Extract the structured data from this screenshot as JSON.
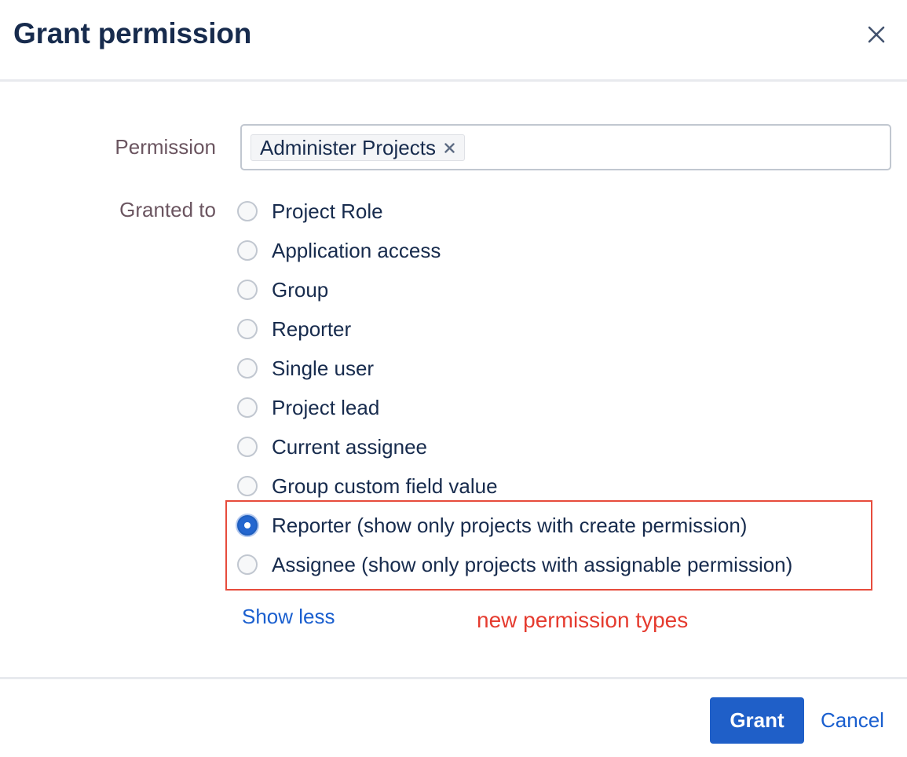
{
  "dialog": {
    "title": "Grant permission",
    "close_icon": "close-icon"
  },
  "permission_field": {
    "label": "Permission",
    "selected_chip": "Administer Projects",
    "chip_remove_icon": "remove-chip-icon"
  },
  "granted_to": {
    "label": "Granted to",
    "selected": "Reporter (show only projects with create permission)",
    "options": [
      {
        "label": "Project Role",
        "checked": false
      },
      {
        "label": "Application access",
        "checked": false
      },
      {
        "label": "Group",
        "checked": false
      },
      {
        "label": "Reporter",
        "checked": false
      },
      {
        "label": "Single user",
        "checked": false
      },
      {
        "label": "Project lead",
        "checked": false
      },
      {
        "label": "Current assignee",
        "checked": false
      },
      {
        "label": "Group custom field value",
        "checked": false
      },
      {
        "label": "Reporter (show only projects with create permission)",
        "checked": true
      },
      {
        "label": "Assignee (show only projects with assignable permission)",
        "checked": false
      }
    ],
    "show_less_label": "Show less"
  },
  "annotation": {
    "text": "new permission types",
    "color": "#e53b2f"
  },
  "footer": {
    "grant_label": "Grant",
    "cancel_label": "Cancel"
  },
  "colors": {
    "primary": "#1f5fc8",
    "link": "#1a5fcf",
    "text": "#172b4d",
    "label": "#6b5560",
    "highlight_border": "#e74c3c"
  }
}
